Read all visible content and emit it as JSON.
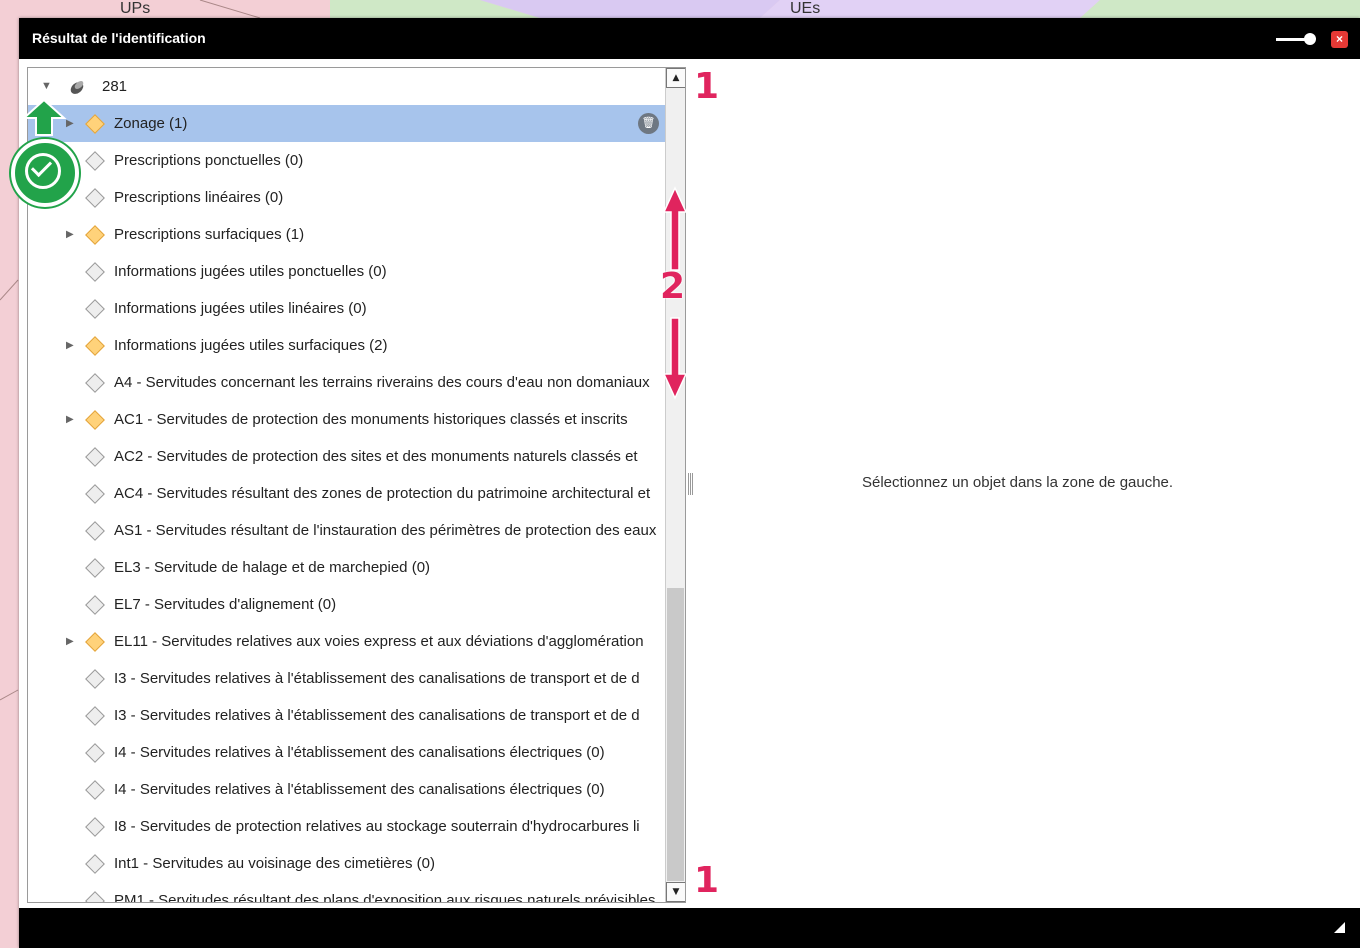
{
  "window": {
    "title": "Résultat de l'identification",
    "close_glyph": "×"
  },
  "map_labels": [
    "UPs",
    "UEs"
  ],
  "tree": {
    "root": {
      "label": "281",
      "expander": "▼",
      "icon": "layer-icon"
    },
    "rows": [
      {
        "label": "Zonage (1)",
        "has_children": true,
        "active": true,
        "selected": true
      },
      {
        "label": "Prescriptions ponctuelles (0)",
        "has_children": false,
        "active": false
      },
      {
        "label": "Prescriptions linéaires (0)",
        "has_children": false,
        "active": false
      },
      {
        "label": "Prescriptions surfaciques (1)",
        "has_children": true,
        "active": true
      },
      {
        "label": "Informations jugées utiles ponctuelles (0)",
        "has_children": false,
        "active": false
      },
      {
        "label": "Informations jugées utiles linéaires (0)",
        "has_children": false,
        "active": false
      },
      {
        "label": "Informations jugées utiles surfaciques (2)",
        "has_children": true,
        "active": true
      },
      {
        "label": "A4 - Servitudes concernant les terrains riverains des cours d'eau non domaniaux",
        "has_children": false,
        "active": false
      },
      {
        "label": "AC1 - Servitudes de protection des monuments historiques classés et inscrits",
        "has_children": true,
        "active": true
      },
      {
        "label": "AC2 - Servitudes de protection des sites et des monuments naturels classés et",
        "has_children": false,
        "active": false
      },
      {
        "label": "AC4 - Servitudes résultant des zones de protection du patrimoine architectural et",
        "has_children": false,
        "active": false
      },
      {
        "label": "AS1 - Servitudes résultant de l'instauration des périmètres de protection des eaux",
        "has_children": false,
        "active": false
      },
      {
        "label": "EL3 - Servitude de halage et de marchepied (0)",
        "has_children": false,
        "active": false
      },
      {
        "label": "EL7 - Servitudes d'alignement (0)",
        "has_children": false,
        "active": false
      },
      {
        "label": "EL11 - Servitudes relatives aux voies express et aux déviations d'agglomération",
        "has_children": true,
        "active": true
      },
      {
        "label": "I3 - Servitudes relatives à l'établissement des canalisations de transport et de d",
        "has_children": false,
        "active": false
      },
      {
        "label": "I3 - Servitudes relatives à l'établissement des canalisations de transport et de d",
        "has_children": false,
        "active": false
      },
      {
        "label": "I4 - Servitudes relatives à l'établissement des canalisations électriques (0)",
        "has_children": false,
        "active": false
      },
      {
        "label": "I4 - Servitudes relatives à l'établissement des canalisations électriques (0)",
        "has_children": false,
        "active": false
      },
      {
        "label": "I8 - Servitudes de protection relatives au stockage souterrain d'hydrocarbures li",
        "has_children": false,
        "active": false
      },
      {
        "label": "Int1 - Servitudes au voisinage des cimetières (0)",
        "has_children": false,
        "active": false
      },
      {
        "label": "PM1 - Servitudes résultant des plans d'exposition aux risques naturels prévisibles",
        "has_children": false,
        "active": false
      }
    ],
    "collapsed_glyph": "▶",
    "trash_glyph": "🗑"
  },
  "scrollbar": {
    "up": "▲",
    "down": "▼"
  },
  "detail": {
    "empty_message": "Sélectionnez un objet dans la zone de gauche."
  },
  "annotations": {
    "one_top": "1",
    "two": "2",
    "one_bottom": "1"
  },
  "colors": {
    "selection": "#a7c4ec",
    "annotation": "#e0245e",
    "badge": "#22a34a"
  }
}
